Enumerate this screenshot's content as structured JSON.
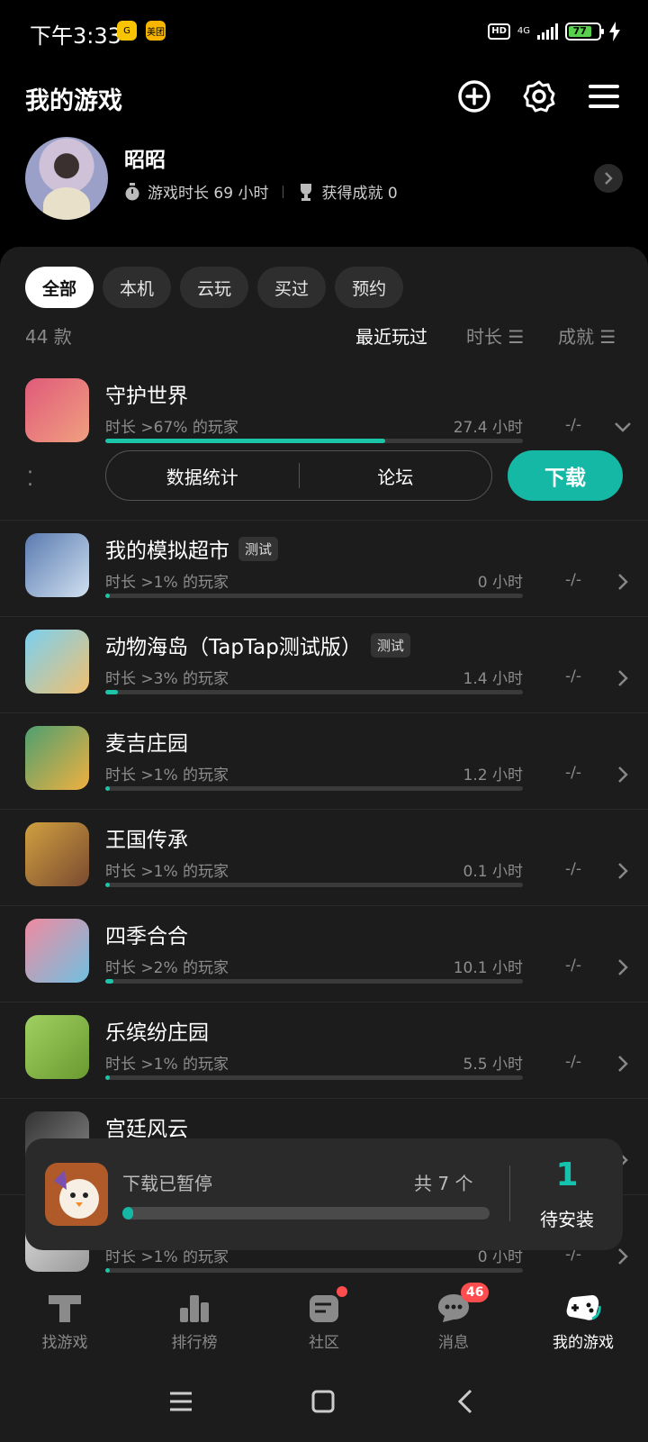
{
  "status": {
    "time": "下午3:33",
    "app_icon_label": "美团",
    "network": "4G",
    "battery": "77",
    "hd": "HD"
  },
  "header": {
    "title": "我的游戏",
    "icons": [
      "add-circle-icon",
      "gear-icon",
      "menu-icon"
    ]
  },
  "profile": {
    "name": "昭昭",
    "playtime": "游戏时长 69 小时",
    "achievements": "获得成就 0"
  },
  "filters": [
    "全部",
    "本机",
    "云玩",
    "买过",
    "预约"
  ],
  "sort": {
    "count": "44 款",
    "recent": "最近玩过",
    "duration": "时长",
    "achievement": "成就"
  },
  "games": [
    {
      "name": "守护世界",
      "tag": "",
      "rank": "时长 >67% 的玩家",
      "hours": "27.4 小时",
      "achievement": "-/-",
      "progress": 0.67
    },
    {
      "name": "我的模拟超市",
      "tag": "测试",
      "rank": "时长 >1% 的玩家",
      "hours": "0 小时",
      "achievement": "-/-",
      "progress": 0.01
    },
    {
      "name": "动物海岛（TapTap测试版）",
      "tag": "测试",
      "rank": "时长 >3% 的玩家",
      "hours": "1.4 小时",
      "achievement": "-/-",
      "progress": 0.03
    },
    {
      "name": "麦吉庄园",
      "tag": "",
      "rank": "时长 >1% 的玩家",
      "hours": "1.2 小时",
      "achievement": "-/-",
      "progress": 0.01
    },
    {
      "name": "王国传承",
      "tag": "",
      "rank": "时长 >1% 的玩家",
      "hours": "0.1 小时",
      "achievement": "-/-",
      "progress": 0.01
    },
    {
      "name": "四季合合",
      "tag": "",
      "rank": "时长 >2% 的玩家",
      "hours": "10.1 小时",
      "achievement": "-/-",
      "progress": 0.02
    },
    {
      "name": "乐缤纷庄园",
      "tag": "",
      "rank": "时长 >1% 的玩家",
      "hours": "5.5 小时",
      "achievement": "-/-",
      "progress": 0.01
    },
    {
      "name": "宫廷风云",
      "tag": "",
      "rank": "",
      "hours": "",
      "achievement": "",
      "progress": 0
    },
    {
      "name": "",
      "tag": "",
      "rank": "时长 >1% 的玩家",
      "hours": "0 小时",
      "achievement": "-/-",
      "progress": 0.01
    }
  ],
  "expanded": {
    "stats": "数据统计",
    "forum": "论坛",
    "download": "下载",
    "more": "⁚"
  },
  "download_card": {
    "status": "下载已暂停",
    "total": "共 7 个",
    "progress": 0.03,
    "pending_count": "1",
    "pending_label": "待安装"
  },
  "tabs": [
    {
      "label": "找游戏",
      "icon": "taptap-logo-icon"
    },
    {
      "label": "排行榜",
      "icon": "ranking-icon"
    },
    {
      "label": "社区",
      "icon": "community-icon"
    },
    {
      "label": "消息",
      "icon": "message-icon",
      "badge": "46"
    },
    {
      "label": "我的游戏",
      "icon": "gamepad-icon",
      "active": true
    }
  ],
  "colors": {
    "accent": "#15b7a5",
    "badge": "#ff4d4f",
    "panel": "#1c1c1c"
  }
}
